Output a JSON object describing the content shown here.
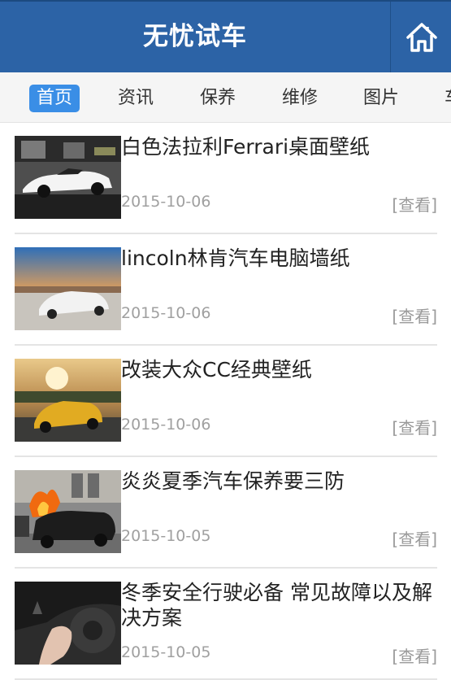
{
  "header": {
    "title": "无忧试车",
    "home_icon": "home-icon"
  },
  "nav": {
    "items": [
      {
        "label": "首页",
        "active": true
      },
      {
        "label": "资讯"
      },
      {
        "label": "保养"
      },
      {
        "label": "维修"
      },
      {
        "label": "图片"
      },
      {
        "label": "车"
      }
    ]
  },
  "articles": [
    {
      "title": "白色法拉利Ferrari桌面壁纸",
      "date": "2015-10-06",
      "view": "[查看]"
    },
    {
      "title": "lincoln林肯汽车电脑墙纸",
      "date": "2015-10-06",
      "view": "[查看]"
    },
    {
      "title": "改装大众CC经典壁纸",
      "date": "2015-10-06",
      "view": "[查看]"
    },
    {
      "title": "炎炎夏季汽车保养要三防",
      "date": "2015-10-05",
      "view": "[查看]"
    },
    {
      "title": "冬季安全行驶必备 常见故障以及解决方案",
      "date": "2015-10-05",
      "view": "[查看]"
    }
  ],
  "colors": {
    "header_bg": "#2c63a6",
    "active_tab": "#3a8ee6"
  }
}
